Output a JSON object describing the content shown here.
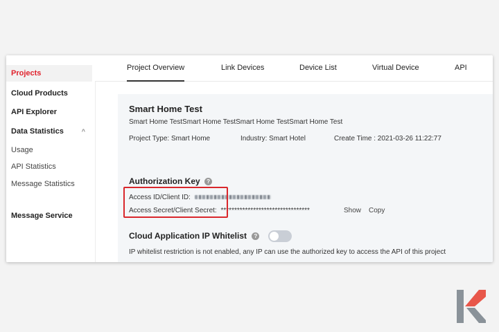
{
  "sidebar": {
    "items": [
      {
        "label": "Projects"
      },
      {
        "label": "Cloud Products"
      },
      {
        "label": "API Explorer"
      },
      {
        "label": "Data Statistics"
      },
      {
        "label": "Usage"
      },
      {
        "label": "API Statistics"
      },
      {
        "label": "Message Statistics"
      },
      {
        "label": "Message Service"
      }
    ],
    "collapse_glyph": "^"
  },
  "tabs": [
    {
      "label": "Project Overview",
      "active": true
    },
    {
      "label": "Link Devices"
    },
    {
      "label": "Device List"
    },
    {
      "label": "Virtual Device"
    },
    {
      "label": "API"
    }
  ],
  "project": {
    "name": "Smart Home Test",
    "description": "Smart Home TestSmart Home TestSmart Home TestSmart Home Test",
    "type_text": "Project Type: Smart Home",
    "industry_text": "Industry: Smart Hotel",
    "create_time_text": "Create Time : 2021-03-26 11:22:77"
  },
  "auth": {
    "heading": "Authorization Key",
    "access_id_label": "Access ID/Client ID:",
    "access_secret_label": "Access Secret/Client Secret:",
    "access_secret_value": "*********************************",
    "show_label": "Show",
    "copy_label": "Copy"
  },
  "whitelist": {
    "heading": "Cloud Application IP Whitelist",
    "enabled": false,
    "note": "IP whitelist restriction is not enabled, any IP can use the authorized key to access the API of this project"
  },
  "help_glyph": "?",
  "colors": {
    "accent_red": "#e0232d",
    "highlight_box": "#d9262b",
    "logo_gray": "#8a9299",
    "logo_red": "#e8574a"
  },
  "icons": [
    "help-icon",
    "chevron-up-icon",
    "brand-logo-icon"
  ]
}
